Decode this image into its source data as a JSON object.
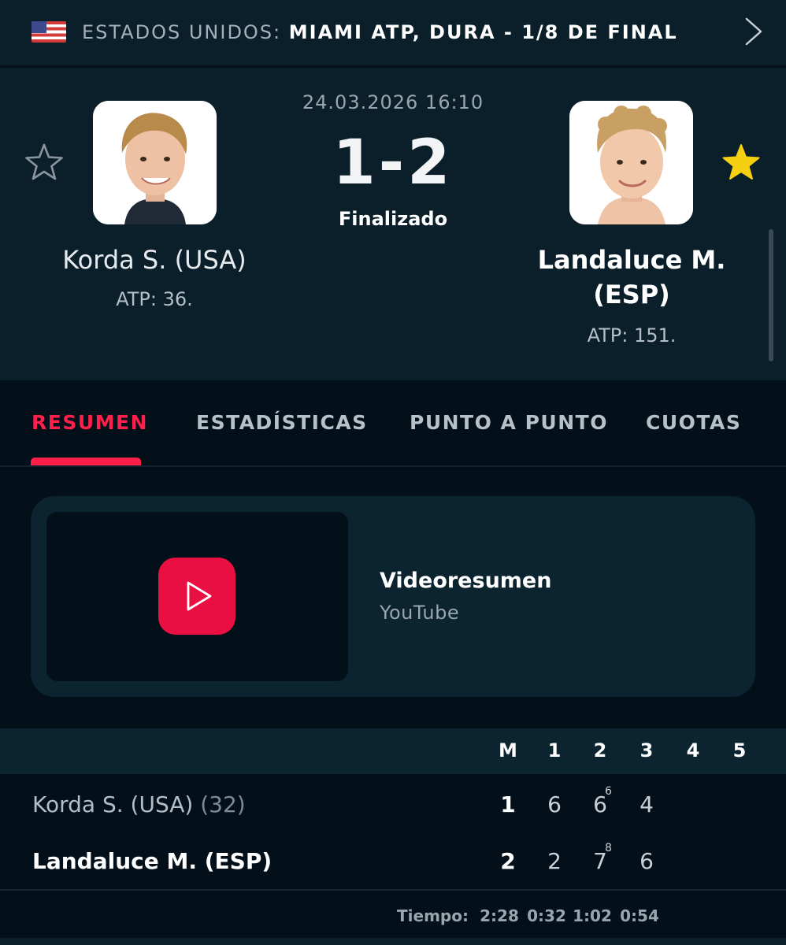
{
  "tournament": {
    "country": "ESTADOS UNIDOS: ",
    "event": "MIAMI ATP, DURA - 1/8 DE FINAL",
    "flag_icon": "us-flag-icon"
  },
  "match": {
    "date": "24.03.2026 16:10",
    "score": "1-2",
    "status": "Finalizado"
  },
  "home": {
    "name": "Korda S. (USA)",
    "rank": "ATP: 36.",
    "favorite": false
  },
  "away": {
    "name": "Landaluce M. (ESP)",
    "rank": "ATP: 151.",
    "favorite": true
  },
  "tabs": [
    {
      "label": "RESUMEN",
      "active": true
    },
    {
      "label": "ESTADÍSTICAS",
      "active": false
    },
    {
      "label": "PUNTO A PUNTO",
      "active": false
    },
    {
      "label": "CUOTAS",
      "active": false
    }
  ],
  "video": {
    "title": "Videoresumen",
    "source": "YouTube"
  },
  "scoreboard": {
    "columns": [
      "M",
      "1",
      "2",
      "3",
      "4",
      "5"
    ],
    "rows": [
      {
        "name": "Korda S. (USA)",
        "seed": "(32)",
        "total": "1",
        "sets": [
          "6",
          "6",
          "4",
          "",
          ""
        ],
        "tiebreaks": [
          "",
          "6",
          "",
          "",
          ""
        ]
      },
      {
        "name": "Landaluce M. (ESP)",
        "seed": "",
        "total": "2",
        "sets": [
          "2",
          "7",
          "6",
          "",
          ""
        ],
        "tiebreaks": [
          "",
          "8",
          "",
          "",
          ""
        ]
      }
    ],
    "time_label": "Tiempo:",
    "times": [
      "2:28",
      "0:32",
      "1:02",
      "0:54"
    ]
  },
  "colors": {
    "accent": "#ff1f4b",
    "favorite_star": "#f5d010",
    "background": "#03101a",
    "panel": "#0b1f2b"
  }
}
